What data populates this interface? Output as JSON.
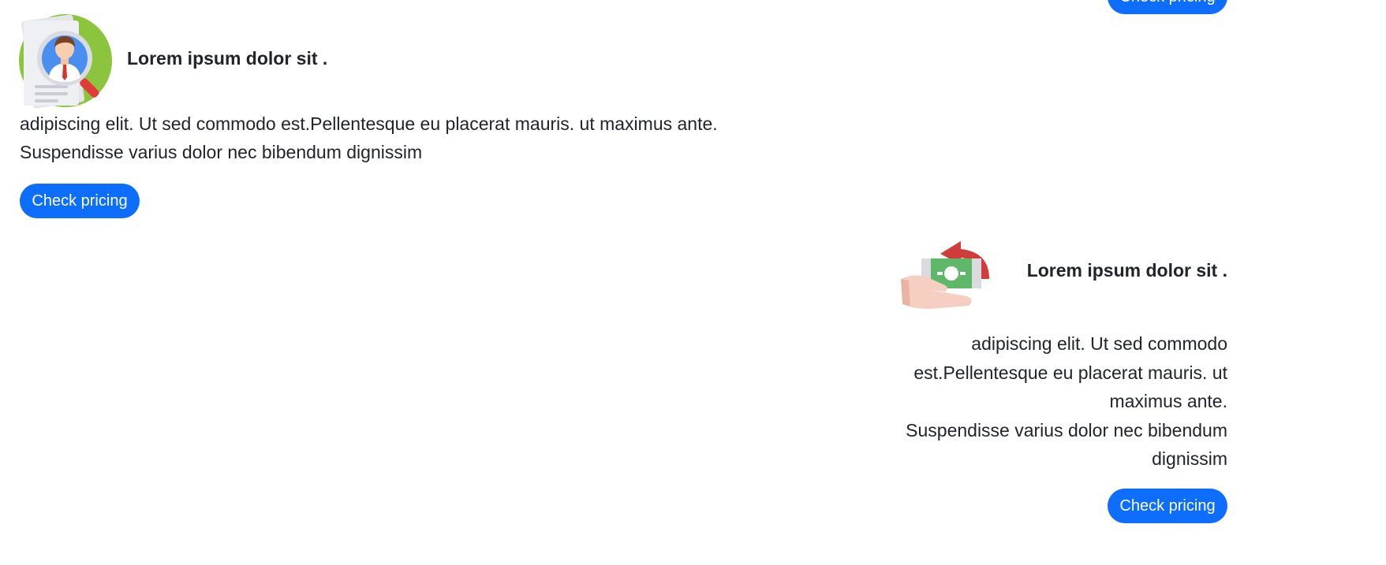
{
  "top_partial": {
    "button_label": "Check pricing"
  },
  "feature_one": {
    "icon": "profile-search-icon",
    "title": "Lorem ipsum dolor sit .",
    "description_line1": "adipiscing elit. Ut sed commodo est.Pellentesque eu placerat mauris. ut maximus ante.",
    "description_line2": "Suspendisse varius dolor nec bibendum dignissim",
    "button_label": "Check pricing"
  },
  "feature_two": {
    "icon": "money-refund-icon",
    "title": "Lorem ipsum dolor sit .",
    "description_line1": "adipiscing elit. Ut sed commodo est.Pellentesque eu placerat mauris. ut maximus ante.",
    "description_line2": "Suspendisse varius dolor nec bibendum dignissim",
    "button_label": "Check pricing"
  },
  "colors": {
    "button_bg": "#0d6efd",
    "button_text": "#ffffff",
    "text": "#212529"
  }
}
